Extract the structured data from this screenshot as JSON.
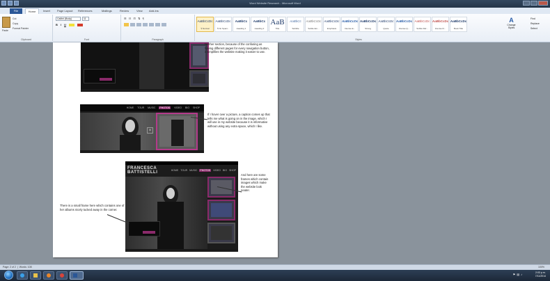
{
  "window": {
    "title": "Word Website Research - Microsoft Word"
  },
  "tabs": [
    "File",
    "Home",
    "Insert",
    "Page Layout",
    "References",
    "Mailings",
    "Review",
    "View",
    "Add-Ins"
  ],
  "clipboard": {
    "paste": "Paste",
    "cut": "Cut",
    "copy": "Copy",
    "format_painter": "Format Painter",
    "label": "Clipboard"
  },
  "font": {
    "name": "Calibri (Body)",
    "size": "11",
    "bold": "B",
    "italic": "I",
    "underline": "U",
    "label": "Font"
  },
  "paragraph": {
    "label": "Paragraph"
  },
  "styles": {
    "label": "Styles",
    "items": [
      {
        "sample": "AaBbCcDc",
        "name": "¶ Normal"
      },
      {
        "sample": "AaBbCcDc",
        "name": "¶ No Spaci..."
      },
      {
        "sample": "AaBbCc",
        "name": "Heading 1"
      },
      {
        "sample": "AaBbCc",
        "name": "Heading 2"
      },
      {
        "sample": "AaB",
        "name": "Title"
      },
      {
        "sample": "AaBbCc",
        "name": "Subtitle"
      },
      {
        "sample": "AaBbCcDc",
        "name": "Subtle Em..."
      },
      {
        "sample": "AaBbCcDc",
        "name": "Emphasis"
      },
      {
        "sample": "AaBbCcDc",
        "name": "Intense E..."
      },
      {
        "sample": "AaBbCcDc",
        "name": "Strong"
      },
      {
        "sample": "AaBbCcDc",
        "name": "Quote"
      },
      {
        "sample": "AaBbCcDc",
        "name": "Intense Q..."
      },
      {
        "sample": "AaBbCcDc",
        "name": "Subtle Ref..."
      },
      {
        "sample": "AaBbCcDc",
        "name": "Intense R..."
      },
      {
        "sample": "AaBbCcDc",
        "name": "Book Title"
      }
    ],
    "change_styles": "Change Styles"
  },
  "editing": {
    "find": "Find",
    "replace": "Replace",
    "select": "Select",
    "label": "Editing"
  },
  "document": {
    "caption1": "Neither section, because of the confusing as having different pages for every navigation button, it simplifies the website making it easier to use.",
    "caption2": "If I hover over a picture, a caption comes up that tells me what is going on in the image, which I will use in my website because it is informative without using any extra space, which I like.",
    "caption3": "And here are some frames which contain images which make the website look neater.",
    "caption4": "There is a small frame here which contains one of her albums nicely tucked away in the corner.",
    "site_nav": [
      "HOME",
      "TOUR",
      "MUSIC",
      "PHOTOS",
      "VIDEO",
      "BIO",
      "SHOP"
    ],
    "site_name_line1": "FRANCESCA",
    "site_name_line2": "BATTISTELLI"
  },
  "status": {
    "page": "Page: 2 of 2",
    "words": "Words: 108",
    "zoom": "100%"
  },
  "taskbar": {
    "time": "2:03 p.m.",
    "date": "7/11/2014"
  }
}
